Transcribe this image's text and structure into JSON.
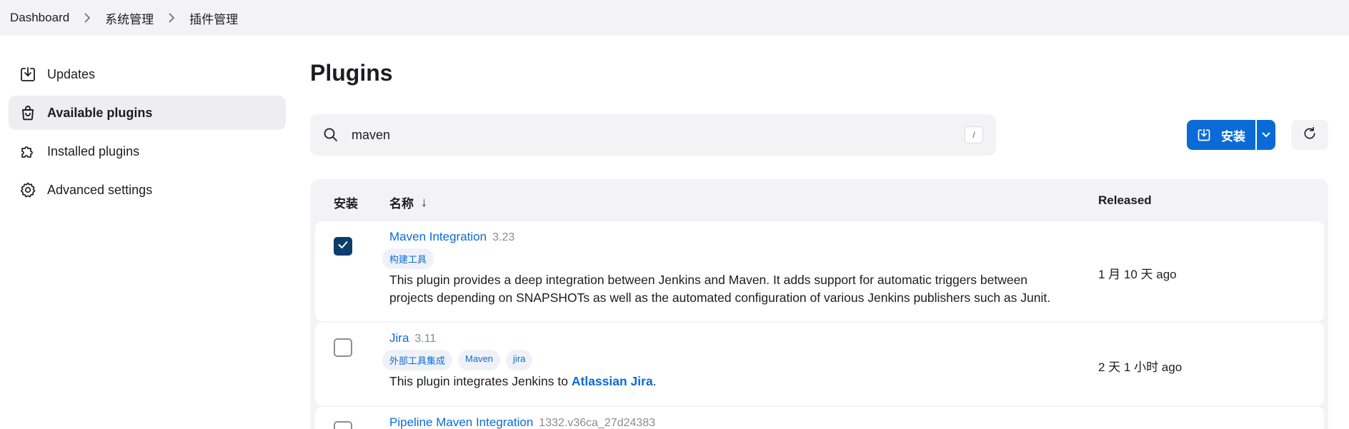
{
  "breadcrumb": {
    "items": [
      "Dashboard",
      "系统管理",
      "插件管理"
    ]
  },
  "sidebar": {
    "items": [
      {
        "label": "Updates",
        "icon": "download-icon"
      },
      {
        "label": "Available plugins",
        "icon": "shopping-bag-icon",
        "active": true
      },
      {
        "label": "Installed plugins",
        "icon": "puzzle-icon"
      },
      {
        "label": "Advanced settings",
        "icon": "gear-icon"
      }
    ]
  },
  "main": {
    "title": "Plugins",
    "search": {
      "value": "maven",
      "shortcut": "/"
    },
    "install_label": "安装",
    "colors": {
      "accent": "#0b6bd6",
      "checked": "#0e3d6a"
    }
  },
  "table": {
    "headers": {
      "install": "安装",
      "name": "名称",
      "sort": "↓",
      "released": "Released"
    },
    "rows": [
      {
        "name": "Maven Integration",
        "version": "3.23",
        "checked": true,
        "tags": [
          "构建工具"
        ],
        "desc_line1": "This plugin provides a deep integration between Jenkins and Maven. It adds support for automatic triggers between",
        "desc_line2": "projects depending on SNAPSHOTs as well as the automated configuration of various Jenkins publishers such as Junit.",
        "released": "1 月 10 天 ago"
      },
      {
        "name": "Jira",
        "version": "3.11",
        "checked": false,
        "tags": [
          "外部工具集成",
          "Maven",
          "jira"
        ],
        "desc_prefix": "This plugin integrates Jenkins to ",
        "desc_link": "Atlassian Jira",
        "desc_suffix": ".",
        "released": "2 天 1 小时 ago"
      },
      {
        "name": "Pipeline Maven Integration",
        "version": "1332.v36ca_27d24383",
        "checked": false
      }
    ]
  }
}
